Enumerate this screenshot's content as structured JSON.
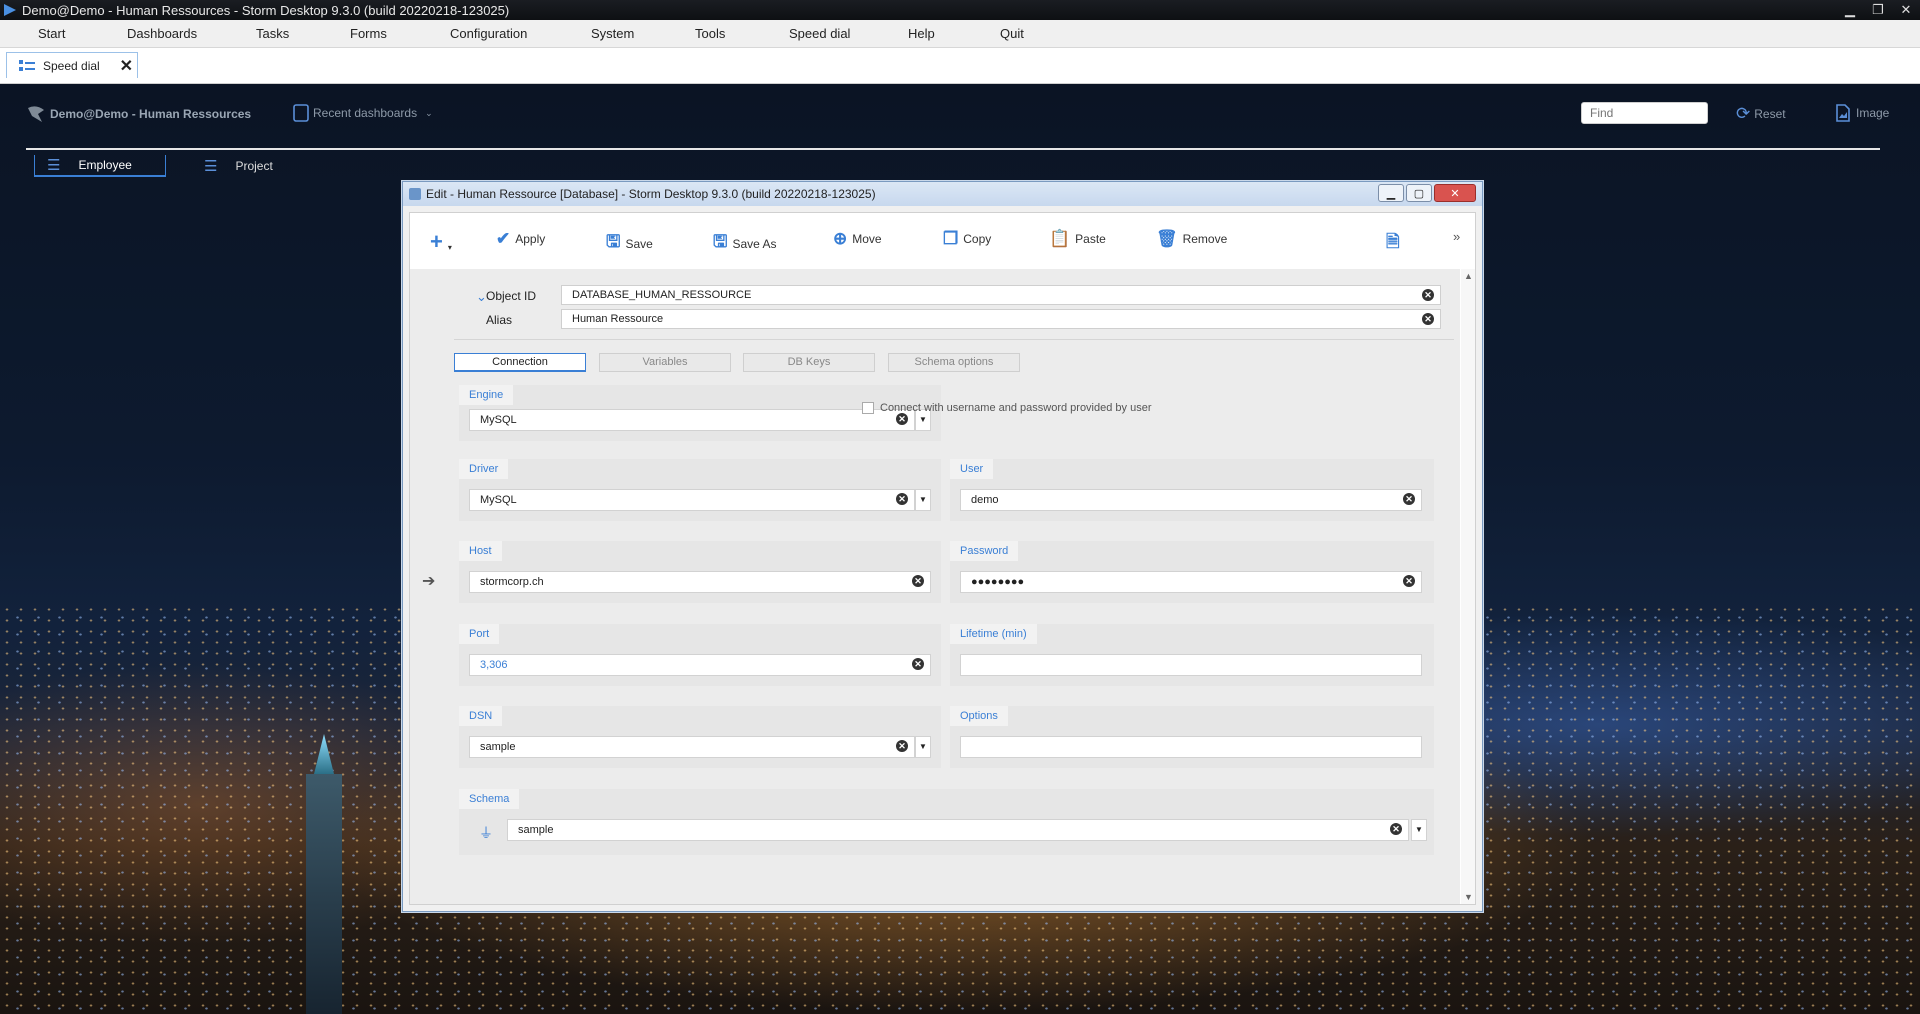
{
  "window": {
    "title": "Demo@Demo - Human Ressources -  Storm Desktop 9.3.0 (build 20220218-123025)"
  },
  "menu": [
    "Start",
    "Dashboards",
    "Tasks",
    "Forms",
    "Configuration",
    "System",
    "Tools",
    "Speed dial",
    "Help",
    "Quit"
  ],
  "tabstrip": {
    "tab_label": "Speed dial"
  },
  "dashboard": {
    "user_label": "Demo@Demo - Human Ressources",
    "recent_label": "Recent dashboards",
    "find_placeholder": "Find",
    "reset_label": "Reset",
    "image_label": "Image",
    "nav": [
      "Employee",
      "Project"
    ]
  },
  "dialog": {
    "title": "Edit - Human Ressource [Database] -  Storm Desktop 9.3.0 (build 20220218-123025)",
    "toolbar": {
      "apply": "Apply",
      "save": "Save",
      "save_as": "Save As",
      "move": "Move",
      "copy": "Copy",
      "paste": "Paste",
      "remove": "Remove"
    },
    "object_id_label": "Object ID",
    "object_id_value": "DATABASE_HUMAN_RESSOURCE",
    "alias_label": "Alias",
    "alias_value": "Human Ressource",
    "tabs": [
      "Connection",
      "Variables",
      "DB Keys",
      "Schema options"
    ],
    "active_tab": "Connection",
    "engine": {
      "label": "Engine",
      "value": "MySQL"
    },
    "connect_checkbox": "Connect with username and password provided by user",
    "driver": {
      "label": "Driver",
      "value": "MySQL"
    },
    "user": {
      "label": "User",
      "value": "demo"
    },
    "host": {
      "label": "Host",
      "value": "stormcorp.ch"
    },
    "password": {
      "label": "Password",
      "value": "●●●●●●●●"
    },
    "port": {
      "label": "Port",
      "value": "3,306"
    },
    "lifetime": {
      "label": "Lifetime (min)",
      "value": ""
    },
    "dsn": {
      "label": "DSN",
      "value": "sample"
    },
    "options": {
      "label": "Options",
      "value": ""
    },
    "schema": {
      "label": "Schema",
      "value": "sample"
    }
  },
  "colors": {
    "accent": "#3a7fd5",
    "close": "#d9534f"
  }
}
